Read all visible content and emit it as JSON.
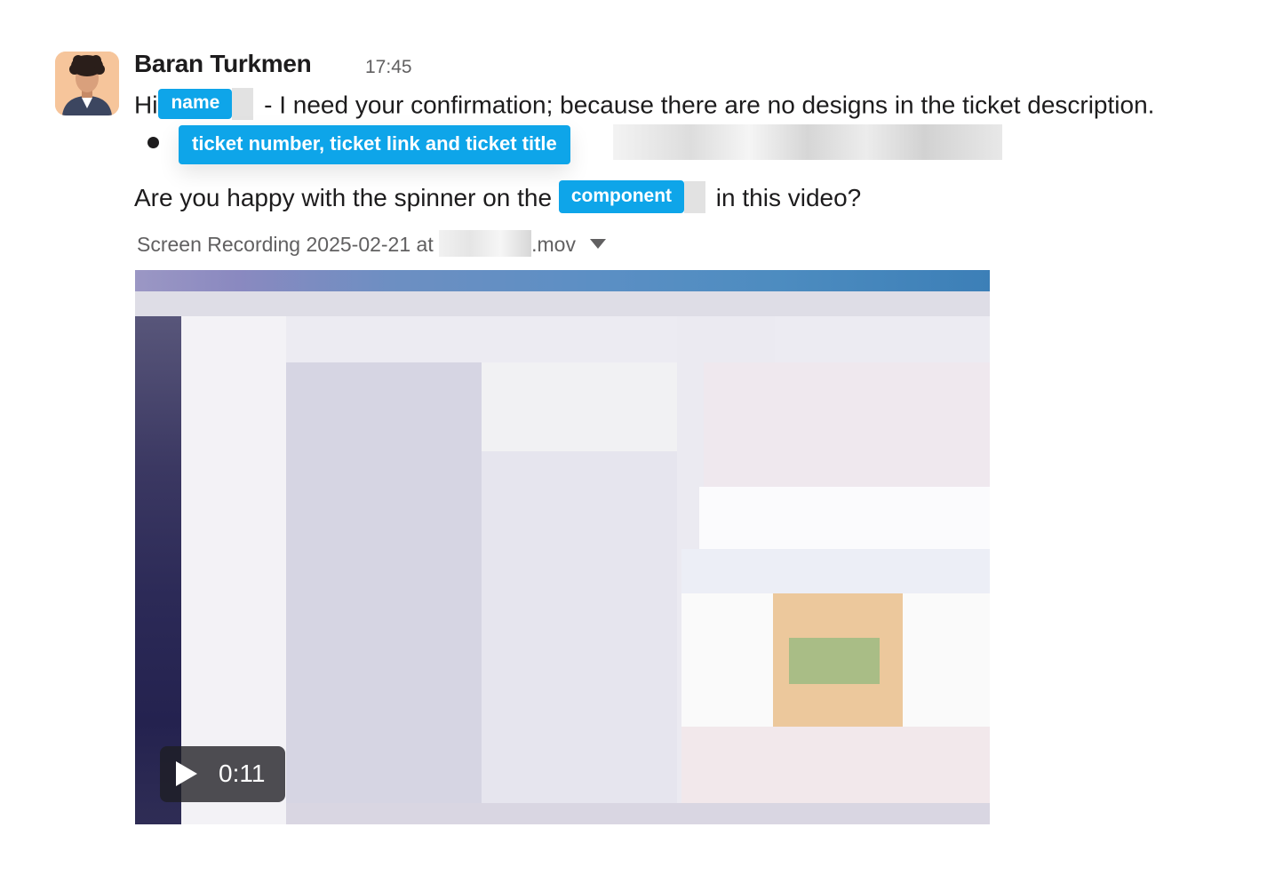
{
  "message": {
    "author": "Baran Turkmen",
    "timestamp": "17:45",
    "line1": {
      "prefix": "Hi",
      "name_tag": "name",
      "suffix": " - I need your confirmation; because there are no designs in the ticket description."
    },
    "bullet_tag": "ticket number, ticket link and ticket title",
    "line3": {
      "prefix": "Are you happy with the spinner on the ",
      "component_tag": "component",
      "suffix": " in this video?"
    },
    "attachment": {
      "name_prefix": "Screen Recording 2025-02-21 at ",
      "name_suffix": ".mov",
      "duration": "0:11"
    }
  },
  "icons": {
    "avatar": "user-avatar",
    "dropdown": "caret-down-icon",
    "play": "play-icon"
  },
  "colors": {
    "tag_background": "#0ea5e9",
    "secondary_text": "#616061"
  }
}
